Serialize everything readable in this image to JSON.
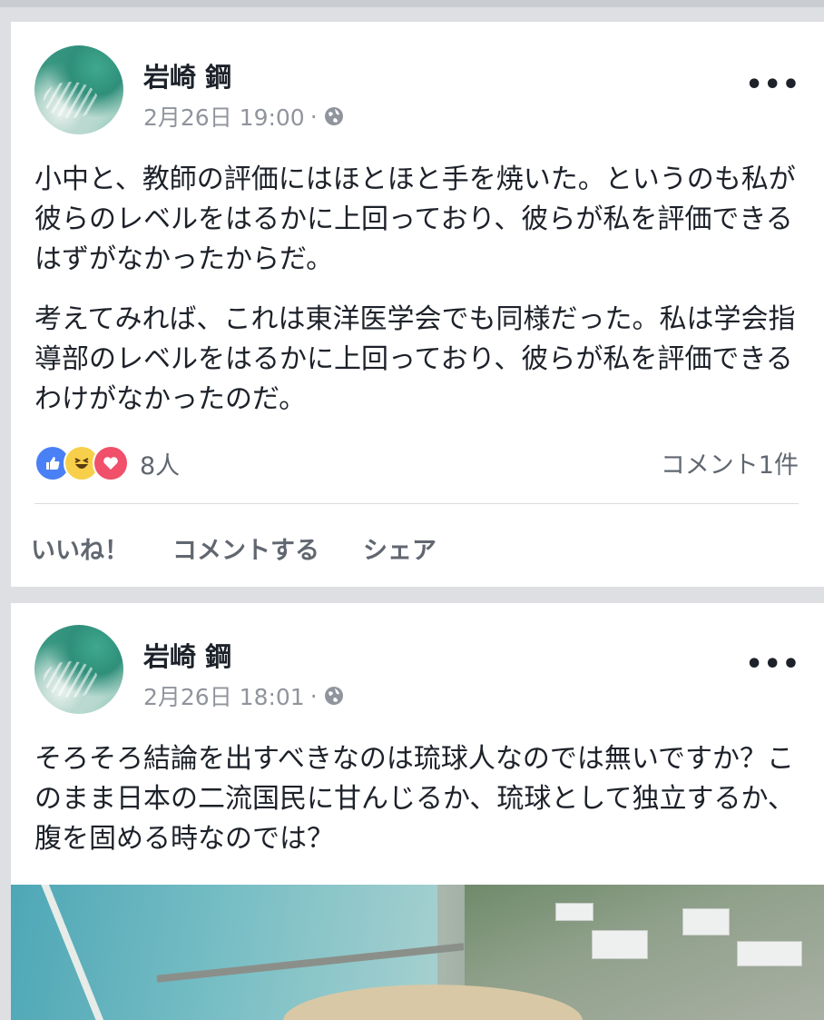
{
  "posts": [
    {
      "author": "岩崎 鋼",
      "timestamp": "2月26日 19:00",
      "meta_sep": "·",
      "privacy_icon": "globe-icon",
      "more": "•••",
      "paragraphs": [
        "小中と、教師の評価にはほとほと手を焼いた。というのも私が彼らのレベルをはるかに上回っており、彼らが私を評価できるはずがなかったからだ。",
        "考えてみれば、これは東洋医学会でも同様だった。私は学会指導部のレベルをはるかに上回っており、彼らが私を評価できるわけがなかったのだ。"
      ],
      "reactions": {
        "types": [
          "like",
          "haha",
          "love"
        ],
        "count": "8人"
      },
      "comments": "コメント1件",
      "actions": {
        "like": "いいね！",
        "comment": "コメントする",
        "share": "シェア"
      }
    },
    {
      "author": "岩崎 鋼",
      "timestamp": "2月26日 18:01",
      "meta_sep": "·",
      "privacy_icon": "globe-icon",
      "more": "•••",
      "paragraphs": [
        "そろそろ結論を出すべきなのは琉球人なのでは無いですか？このまま日本の二流国民に甘んじるか、琉球として独立するか、腹を固める時なのでは？"
      ],
      "photo": "aerial-coastal-construction-photo"
    }
  ],
  "colors": {
    "feed_bg": "#dddfe2",
    "card_bg": "#ffffff",
    "text": "#1d2129",
    "secondary": "#90949c",
    "like_blue": "#4a80f5",
    "haha_yellow": "#f7cf4a",
    "love_red": "#f0506a"
  }
}
